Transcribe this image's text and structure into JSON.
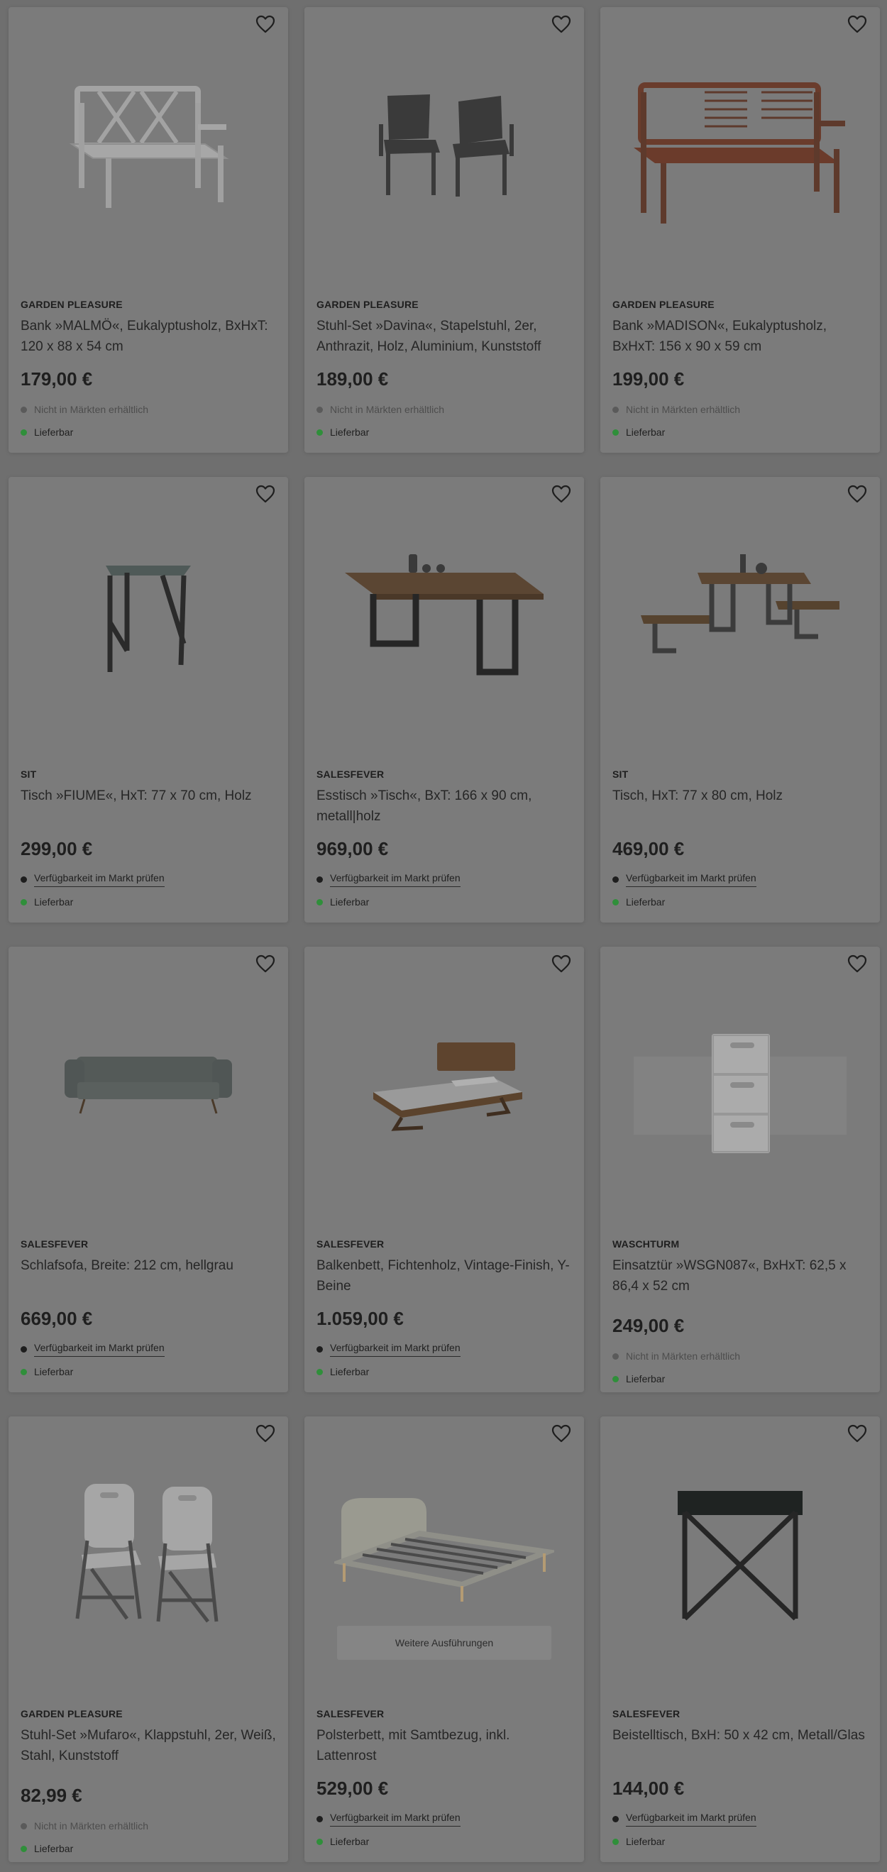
{
  "colors": {
    "overlay_background": "#6f6f6f",
    "card_background": "#7b7b7b",
    "available_dot": "#2f8f3a"
  },
  "wishlist_icon": "heart-outline-icon",
  "products": [
    {
      "brand": "GARDEN PLEASURE",
      "title": "Bank »MALMÖ«, Eukalyptusholz, BxHxT: 120 x 88 x 54 cm",
      "price": "179,00 €",
      "store_availability": "Nicht in Märkten erhältlich",
      "store_check_link": null,
      "delivery": "Lieferbar",
      "image": "white wooden garden bench"
    },
    {
      "brand": "GARDEN PLEASURE",
      "title": "Stuhl-Set »Davina«, Stapelstuhl, 2er, Anthrazit, Holz, Aluminium, Kunststoff",
      "price": "189,00 €",
      "store_availability": "Nicht in Märkten erhältlich",
      "store_check_link": null,
      "delivery": "Lieferbar",
      "image": "two anthracite stacking chairs"
    },
    {
      "brand": "GARDEN PLEASURE",
      "title": "Bank »MADISON«, Eukalyptusholz, BxHxT: 156 x 90 x 59 cm",
      "price": "199,00 €",
      "store_availability": "Nicht in Märkten erhältlich",
      "store_check_link": null,
      "delivery": "Lieferbar",
      "image": "red-brown wooden garden bench"
    },
    {
      "brand": "SIT",
      "title": "Tisch »FIUME«, HxT: 77 x 70 cm, Holz",
      "price": "299,00 €",
      "store_availability": null,
      "store_check_link": "Verfügbarkeit im Markt prüfen",
      "delivery": "Lieferbar",
      "image": "square bistro table with metal legs"
    },
    {
      "brand": "SALESFEVER",
      "title": "Esstisch »Tisch«, BxT: 166 x 90 cm, metall|holz",
      "price": "969,00 €",
      "store_availability": null,
      "store_check_link": "Verfügbarkeit im Markt prüfen",
      "delivery": "Lieferbar",
      "image": "wooden dining table with u-shaped legs"
    },
    {
      "brand": "SIT",
      "title": "Tisch, HxT: 77 x 80 cm, Holz",
      "price": "469,00 €",
      "store_availability": null,
      "store_check_link": "Verfügbarkeit im Markt prüfen",
      "delivery": "Lieferbar",
      "image": "table with two benches"
    },
    {
      "brand": "SALESFEVER",
      "title": "Schlafsofa, Breite: 212 cm, hellgrau",
      "price": "669,00 €",
      "store_availability": null,
      "store_check_link": "Verfügbarkeit im Markt prüfen",
      "delivery": "Lieferbar",
      "image": "light grey sofa bed"
    },
    {
      "brand": "SALESFEVER",
      "title": "Balkenbett, Fichtenholz, Vintage-Finish, Y-Beine",
      "price": "1.059,00 €",
      "store_availability": null,
      "store_check_link": "Verfügbarkeit im Markt prüfen",
      "delivery": "Lieferbar",
      "image": "wooden bed with y-legs"
    },
    {
      "brand": "WASCHTURM",
      "title": "Einsatztür »WSGN087«, BxHxT: 62,5 x 86,4 x 52 cm",
      "price": "249,00 €",
      "store_availability": "Nicht in Märkten erhältlich",
      "store_check_link": null,
      "delivery": "Lieferbar",
      "image": "white washing machine cabinet"
    },
    {
      "brand": "GARDEN PLEASURE",
      "title": "Stuhl-Set »Mufaro«, Klappstuhl, 2er, Weiß, Stahl, Kunststoff",
      "price": "82,99 €",
      "store_availability": "Nicht in Märkten erhältlich",
      "store_check_link": null,
      "delivery": "Lieferbar",
      "image": "two white folding chairs"
    },
    {
      "brand": "SALESFEVER",
      "title": "Polsterbett, mit Samtbezug, inkl. Lattenrost",
      "price": "529,00 €",
      "store_availability": null,
      "store_check_link": "Verfügbarkeit im Markt prüfen",
      "delivery": "Lieferbar",
      "variants_button": "Weitere Ausführungen",
      "image": "upholstered velvet bed with slatted frame"
    },
    {
      "brand": "SALESFEVER",
      "title": "Beistelltisch, BxH: 50 x 42 cm, Metall/Glas",
      "price": "144,00 €",
      "store_availability": null,
      "store_check_link": "Verfügbarkeit im Markt prüfen",
      "delivery": "Lieferbar",
      "image": "black marble side table"
    }
  ]
}
